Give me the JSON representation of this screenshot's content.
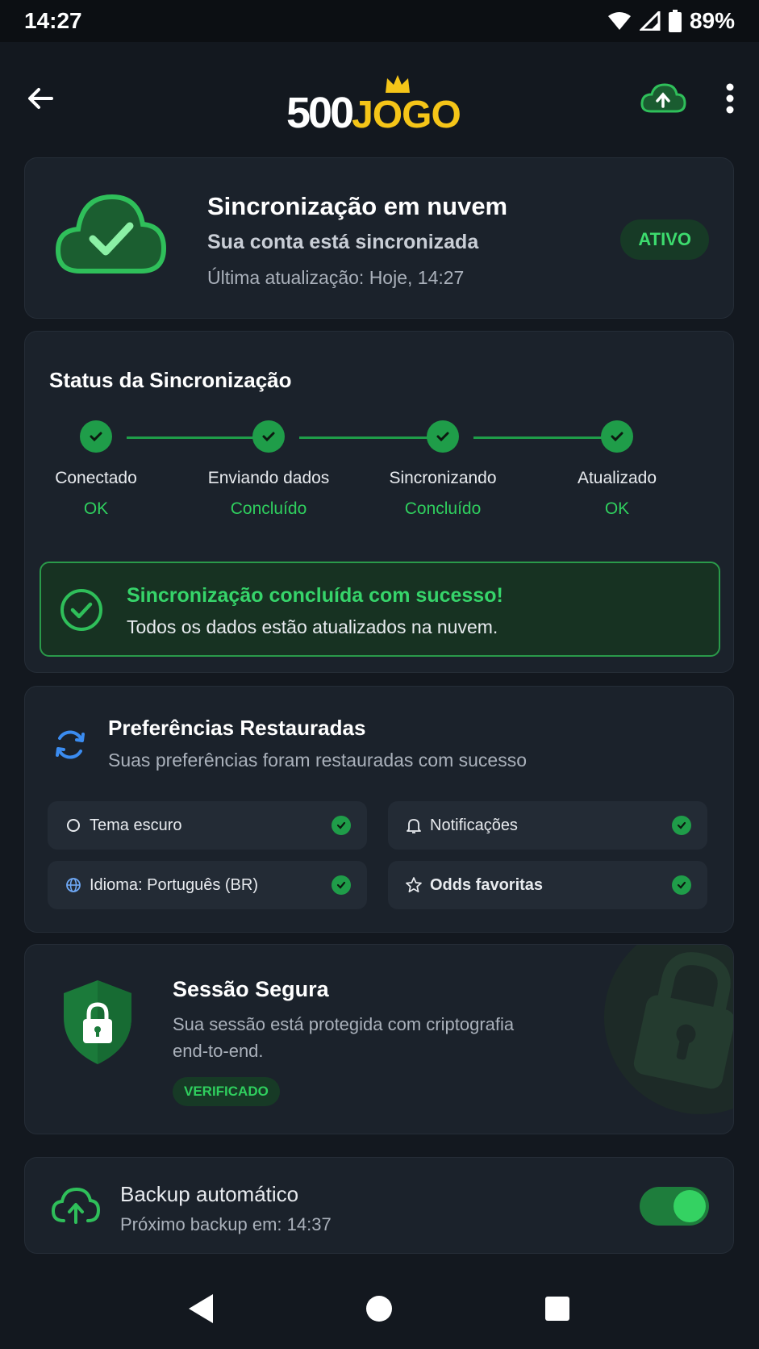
{
  "status_bar": {
    "time": "14:27",
    "battery": "89%"
  },
  "app": {
    "logo_500": "500",
    "logo_jogo": "JOGO"
  },
  "cloud_card": {
    "title": "Sincronização em nuvem",
    "subtitle": "Sua conta está sincronizada",
    "last_update": "Última atualização: Hoje, 14:27",
    "badge": "ATIVO"
  },
  "sync_status": {
    "title": "Status da Sincronização",
    "steps": [
      {
        "label": "Conectado",
        "status": "OK"
      },
      {
        "label": "Enviando dados",
        "status": "Concluído"
      },
      {
        "label": "Sincronizando",
        "status": "Concluído"
      },
      {
        "label": "Atualizado",
        "status": "OK"
      }
    ],
    "success_title": "Sincronização concluída com sucesso!",
    "success_text": "Todos os dados estão atualizados na nuvem."
  },
  "preferences": {
    "title": "Preferências Restauradas",
    "subtitle": "Suas preferências foram restauradas com sucesso",
    "items": [
      {
        "label": "Tema escuro",
        "icon": "theme-icon"
      },
      {
        "label": "Notificações",
        "icon": "bell-icon"
      },
      {
        "label": "Idioma: Português (BR)",
        "icon": "globe-icon"
      },
      {
        "label": "Odds favoritas",
        "icon": "star-icon"
      }
    ]
  },
  "secure_session": {
    "title": "Sessão Segura",
    "text": "Sua sessão está protegida com criptografia end-to-end.",
    "badge": "VERIFICADO"
  },
  "backup": {
    "title": "Backup automático",
    "next": "Próximo backup em: 14:37",
    "enabled": true
  },
  "colors": {
    "accent": "#1f9d49",
    "accent_text": "#36d46a",
    "brand_yellow": "#f5c518",
    "background": "#13181f",
    "card": "#1b222b"
  }
}
